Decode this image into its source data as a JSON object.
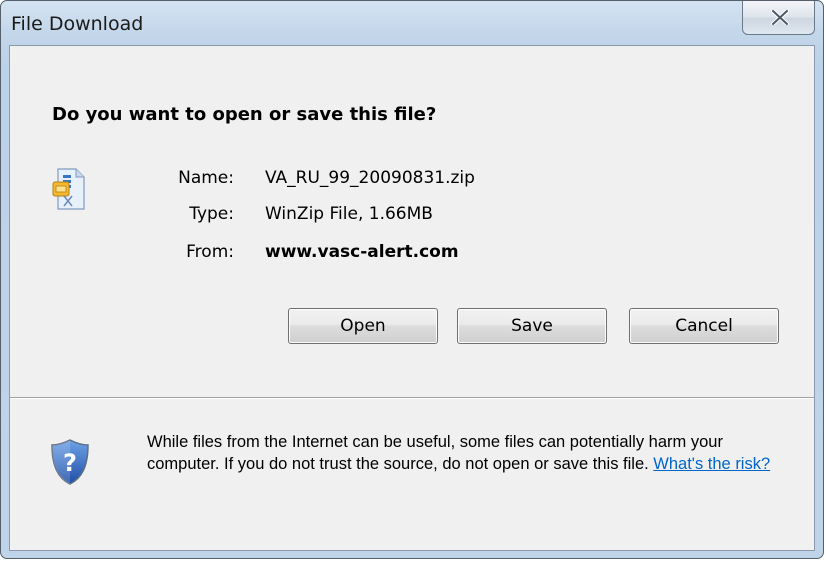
{
  "window": {
    "title": "File Download",
    "close_icon": "close-icon"
  },
  "dialog": {
    "question": "Do you want to open or save this file?",
    "file_icon": "zip-file-icon",
    "fields": {
      "name_label": "Name:",
      "name_value": "VA_RU_99_20090831.zip",
      "type_label": "Type:",
      "type_value": "WinZip File, 1.66MB",
      "from_label": "From:",
      "from_value": "www.vasc-alert.com"
    },
    "buttons": {
      "open": "Open",
      "save": "Save",
      "cancel": "Cancel"
    },
    "warning": {
      "icon": "shield-question-icon",
      "text": "While files from the Internet can be useful, some files can potentially harm your computer. If you do not trust the source, do not open or save this file.",
      "link": "What's the risk?"
    }
  },
  "colors": {
    "title_gradient_top": "#d4e3f2",
    "client_bg": "#f0f0f0",
    "link": "#0066cc"
  }
}
